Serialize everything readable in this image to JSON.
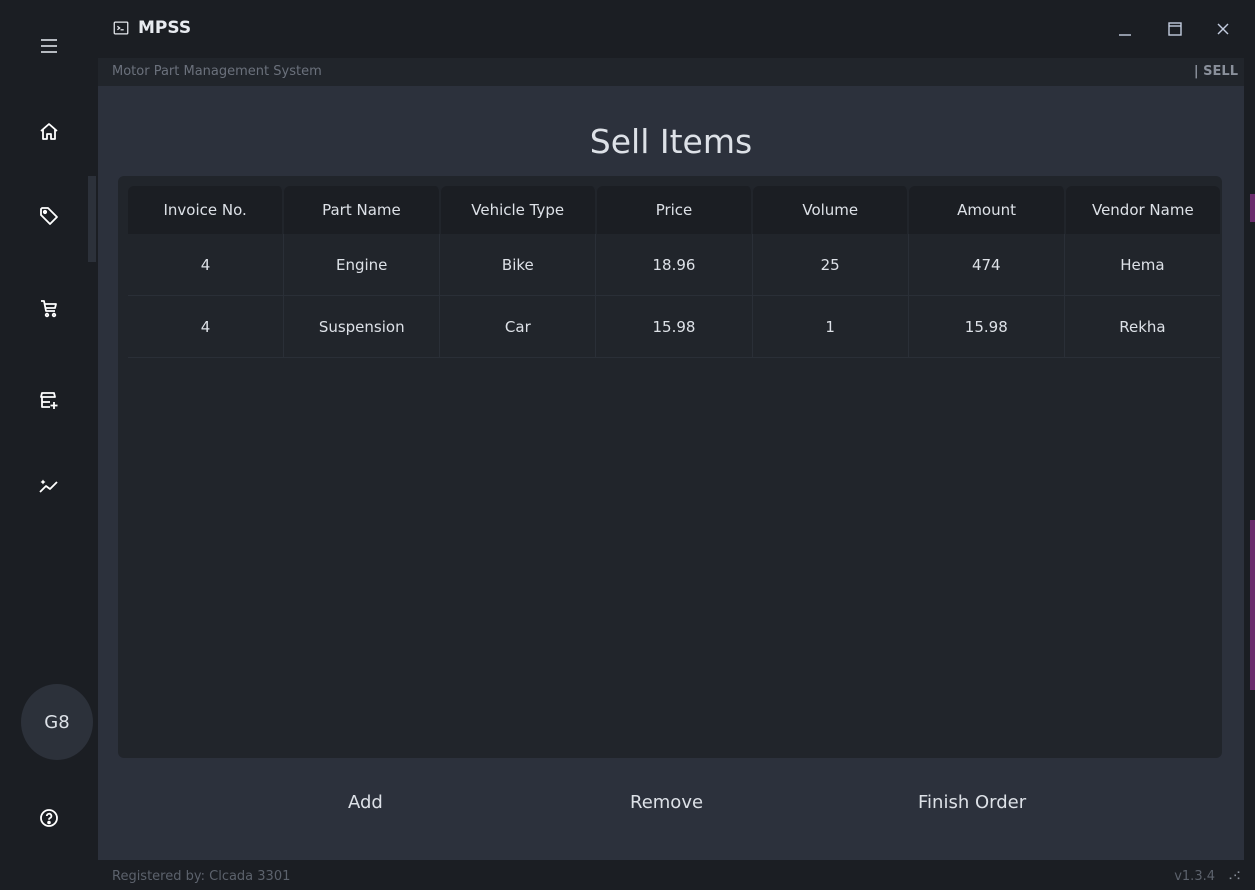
{
  "app": {
    "title": "MPSS",
    "subtitle": "Motor Part Management System",
    "section": "| SELL"
  },
  "sidebar": {
    "items": [
      {
        "name": "menu",
        "icon": "hamburger-menu-icon"
      },
      {
        "name": "home",
        "icon": "home-icon"
      },
      {
        "name": "tags",
        "icon": "tag-icon"
      },
      {
        "name": "cart",
        "icon": "cart-icon"
      },
      {
        "name": "store-add",
        "icon": "store-add-icon"
      },
      {
        "name": "analytics",
        "icon": "chart-sparkle-icon"
      },
      {
        "name": "help",
        "icon": "help-circle-icon"
      }
    ],
    "avatar_label": "G8"
  },
  "page": {
    "title": "Sell Items"
  },
  "table": {
    "columns": [
      "Invoice No.",
      "Part Name",
      "Vehicle Type",
      "Price",
      "Volume",
      "Amount",
      "Vendor Name"
    ],
    "rows": [
      [
        "4",
        "Engine",
        "Bike",
        "18.96",
        "25",
        "474",
        "Hema"
      ],
      [
        "4",
        "Suspension",
        "Car",
        "15.98",
        "1",
        "15.98",
        "Rekha"
      ]
    ]
  },
  "actions": {
    "add": "Add",
    "remove": "Remove",
    "finish": "Finish Order"
  },
  "status": {
    "registered": "Registered by: Clcada 3301",
    "version": "v1.3.4"
  },
  "colors": {
    "background": "#1b1e23",
    "content": "#2c313c",
    "table_bg": "#21252b",
    "text": "#dde1e7",
    "accent_edge": "#6a2c6d"
  }
}
